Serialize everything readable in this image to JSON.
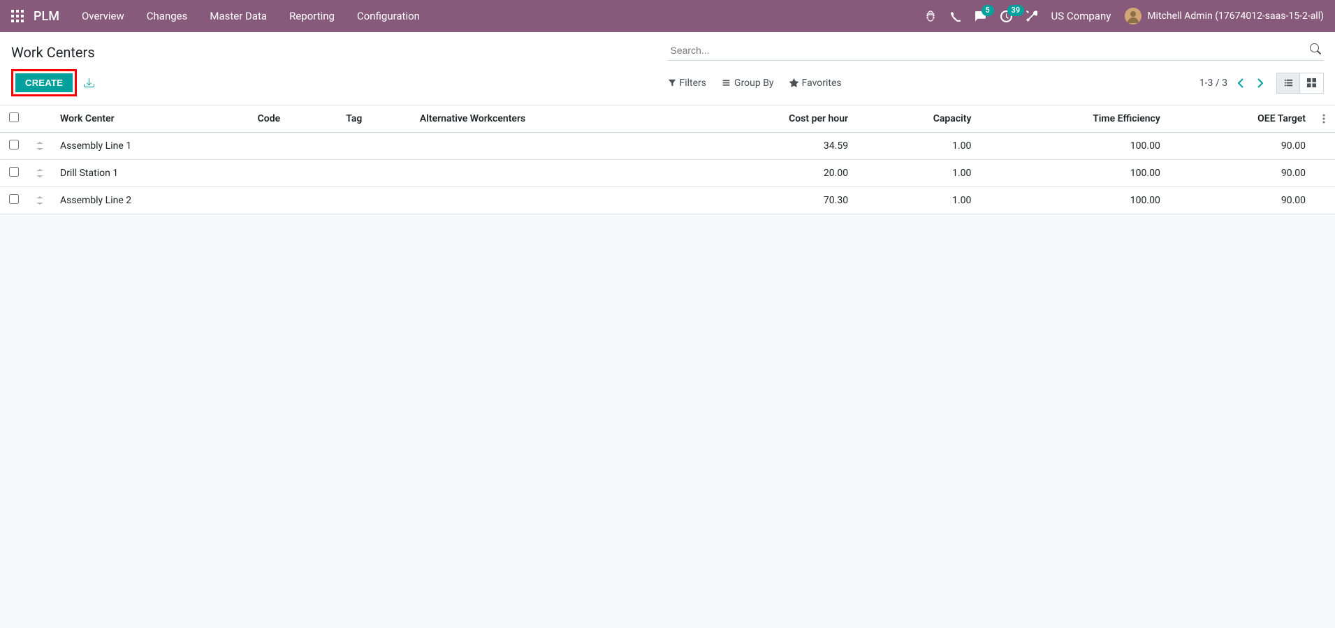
{
  "nav": {
    "brand": "PLM",
    "items": [
      "Overview",
      "Changes",
      "Master Data",
      "Reporting",
      "Configuration"
    ],
    "messages_badge": "5",
    "activities_badge": "39",
    "company": "US Company",
    "user": "Mitchell Admin (17674012-saas-15-2-all)"
  },
  "breadcrumb": "Work Centers",
  "buttons": {
    "create": "CREATE"
  },
  "search": {
    "placeholder": "Search..."
  },
  "filters": {
    "filters": "Filters",
    "groupby": "Group By",
    "favorites": "Favorites"
  },
  "pager": {
    "range": "1-3 / 3"
  },
  "table": {
    "headers": {
      "work_center": "Work Center",
      "code": "Code",
      "tag": "Tag",
      "alt": "Alternative Workcenters",
      "cost": "Cost per hour",
      "capacity": "Capacity",
      "eff": "Time Efficiency",
      "oee": "OEE Target"
    },
    "rows": [
      {
        "work_center": "Assembly Line 1",
        "code": "",
        "tag": "",
        "alt": "",
        "cost": "34.59",
        "capacity": "1.00",
        "eff": "100.00",
        "oee": "90.00"
      },
      {
        "work_center": "Drill Station 1",
        "code": "",
        "tag": "",
        "alt": "",
        "cost": "20.00",
        "capacity": "1.00",
        "eff": "100.00",
        "oee": "90.00"
      },
      {
        "work_center": "Assembly Line 2",
        "code": "",
        "tag": "",
        "alt": "",
        "cost": "70.30",
        "capacity": "1.00",
        "eff": "100.00",
        "oee": "90.00"
      }
    ]
  }
}
